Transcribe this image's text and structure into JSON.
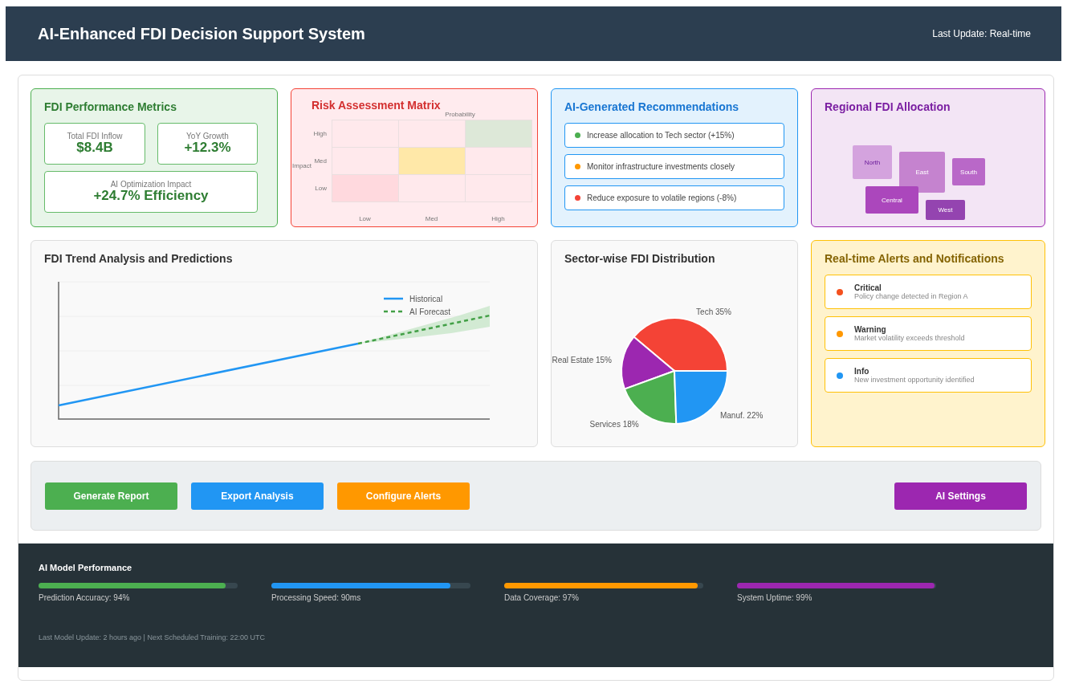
{
  "header": {
    "title": "AI-Enhanced FDI Decision Support System",
    "last_update": "Last Update: Real-time"
  },
  "metrics": {
    "title": "FDI Performance Metrics",
    "tiles": [
      {
        "label": "Total FDI Inflow",
        "value": "$8.4B"
      },
      {
        "label": "YoY Growth",
        "value": "+12.3%"
      },
      {
        "label": "AI Optimization Impact",
        "value": "+24.7% Efficiency"
      }
    ]
  },
  "risk_matrix": {
    "title": "Risk Assessment Matrix",
    "x_axis": "Probability",
    "y_axis": "Impact",
    "columns": [
      "Low",
      "Med",
      "High"
    ],
    "rows": [
      {
        "label": "High",
        "cells": [
          {
            "color": "#ffe9ec"
          },
          {
            "color": "#ffe9ec"
          },
          {
            "color": "#dde8d8"
          }
        ]
      },
      {
        "label": "Med",
        "cells": [
          {
            "color": "#ffe9ec"
          },
          {
            "color": "#ffe8a8"
          },
          {
            "color": "#ffe9ec"
          }
        ]
      },
      {
        "label": "Low",
        "cells": [
          {
            "color": "#ffd9de"
          },
          {
            "color": "#ffe9ec"
          },
          {
            "color": "#ffe9ec"
          }
        ]
      }
    ]
  },
  "recommendations": {
    "title": "AI-Generated Recommendations",
    "items": [
      {
        "text": "Increase allocation to Tech sector (+15%)",
        "color": "#4caf50"
      },
      {
        "text": "Monitor infrastructure investments closely",
        "color": "#ff9800"
      },
      {
        "text": "Reduce exposure to volatile regions (-8%)",
        "color": "#f44336"
      }
    ]
  },
  "regional": {
    "title": "Regional FDI Allocation",
    "regions": [
      {
        "name": "North",
        "color": "#d4a3de"
      },
      {
        "name": "East",
        "color": "#c583cf"
      },
      {
        "name": "South",
        "color": "#b968c8"
      },
      {
        "name": "Central",
        "color": "#ab47bc"
      },
      {
        "name": "West",
        "color": "#9444b0"
      }
    ]
  },
  "trend": {
    "title": "FDI Trend Analysis and Predictions",
    "legend": [
      "Historical",
      "AI Forecast"
    ]
  },
  "sectors": {
    "title": "Sector-wise FDI Distribution",
    "chart_data": {
      "type": "pie",
      "categories": [
        "Tech",
        "Real Estate",
        "Services",
        "Manuf."
      ],
      "values": [
        35,
        15,
        18,
        22
      ],
      "colors": [
        "#f44336",
        "#9c27b0",
        "#4caf50",
        "#2196f3"
      ],
      "value_labels": [
        "35%",
        "15%",
        "18%",
        "22%"
      ]
    }
  },
  "alerts": {
    "title": "Real-time Alerts and Notifications",
    "items": [
      {
        "title": "Critical",
        "text": "Policy change detected in Region A",
        "color": "#f4511e"
      },
      {
        "title": "Warning",
        "text": "Market volatility exceeds threshold",
        "color": "#ff9800"
      },
      {
        "title": "Info",
        "text": "New investment opportunity identified",
        "color": "#2196f3"
      }
    ]
  },
  "action_bar": {
    "buttons": [
      {
        "label": "Generate Report",
        "color": "#4caf50"
      },
      {
        "label": "Export Analysis",
        "color": "#2196f3"
      },
      {
        "label": "Configure Alerts",
        "color": "#ff9800"
      }
    ],
    "settings_button": {
      "label": "AI Settings",
      "color": "#9c27b0"
    }
  },
  "model_performance": {
    "title": "AI Model Performance",
    "meters": [
      {
        "label": "Prediction Accuracy: 94%",
        "level": 0.94,
        "color": "#4caf50"
      },
      {
        "label": "Processing Speed: 90ms",
        "level": 0.9,
        "color": "#2196f3"
      },
      {
        "label": "Data Coverage: 97%",
        "level": 0.97,
        "color": "#ff9800"
      },
      {
        "label": "System Uptime: 99%",
        "level": 0.99,
        "color": "#9c27b0"
      }
    ],
    "note": "Last Model Update: 2 hours ago | Next Scheduled Training: 22:00 UTC"
  }
}
